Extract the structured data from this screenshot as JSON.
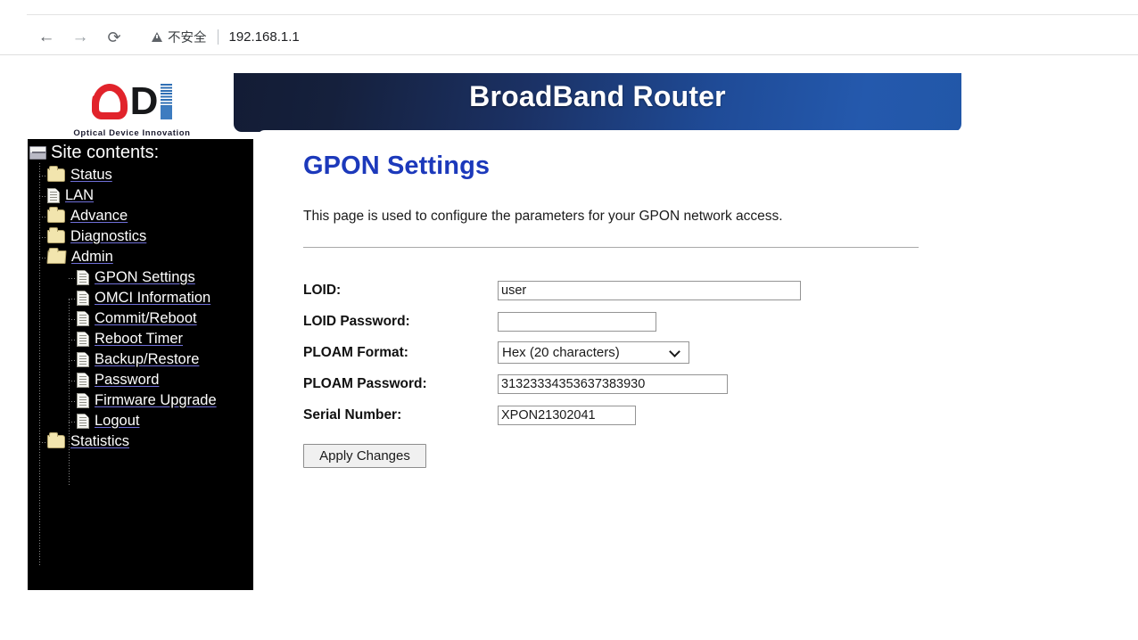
{
  "browser": {
    "back_icon": "arrow-left-icon",
    "forward_icon": "arrow-right-icon",
    "reload_icon": "reload-icon",
    "back_glyph": "←",
    "forward_glyph": "→",
    "reload_glyph": "⟳",
    "security_icon": "warning-triangle-icon",
    "security_label": "不安全",
    "url": "192.168.1.1"
  },
  "logo": {
    "letter_d": "D",
    "tagline": "Optical Device Innovation",
    "o_color": "#e1232b",
    "d_color": "#17181a",
    "i_color": "#3d7cc0"
  },
  "banner": {
    "title": "BroadBand Router",
    "gradient_from": "#131c35",
    "gradient_to": "#2257a8"
  },
  "sidebar": {
    "root_label": "Site contents:",
    "root_icon": "book-icon",
    "items": [
      {
        "label": "Status",
        "icon": "folder-icon",
        "level": 1
      },
      {
        "label": "LAN",
        "icon": "page-icon",
        "level": 1
      },
      {
        "label": "Advance",
        "icon": "folder-icon",
        "level": 1
      },
      {
        "label": "Diagnostics",
        "icon": "folder-icon",
        "level": 1
      },
      {
        "label": "Admin",
        "icon": "folder-open-icon",
        "level": 1
      },
      {
        "label": "GPON Settings",
        "icon": "page-icon",
        "level": 2
      },
      {
        "label": "OMCI Information",
        "icon": "page-icon",
        "level": 2
      },
      {
        "label": "Commit/Reboot",
        "icon": "page-icon",
        "level": 2
      },
      {
        "label": "Reboot Timer",
        "icon": "page-icon",
        "level": 2
      },
      {
        "label": "Backup/Restore",
        "icon": "page-icon",
        "level": 2
      },
      {
        "label": "Password",
        "icon": "page-icon",
        "level": 2
      },
      {
        "label": "Firmware Upgrade",
        "icon": "page-icon",
        "level": 2
      },
      {
        "label": "Logout",
        "icon": "page-icon",
        "level": 2
      },
      {
        "label": "Statistics",
        "icon": "folder-icon",
        "level": 1
      }
    ],
    "background": "#000000",
    "text_color": "#ffffff"
  },
  "main": {
    "heading": "GPON Settings",
    "heading_color": "#1c39bb",
    "description": "This page is used to configure the parameters for your GPON network access.",
    "fields": {
      "loid": {
        "label": "LOID:",
        "value": "user",
        "placeholder": ""
      },
      "loid_password": {
        "label": "LOID Password:",
        "value": "",
        "placeholder": ""
      },
      "ploam_format": {
        "label": "PLOAM Format:",
        "selected": "Hex (20 characters)",
        "options": [
          "Hex (20 characters)"
        ],
        "chevron_icon": "chevron-down-icon"
      },
      "ploam_password": {
        "label": "PLOAM Password:",
        "value": "31323334353637383930",
        "placeholder": ""
      },
      "serial_number": {
        "label": "Serial Number:",
        "value": "XPON21302041",
        "placeholder": ""
      }
    },
    "apply_button": "Apply Changes"
  }
}
